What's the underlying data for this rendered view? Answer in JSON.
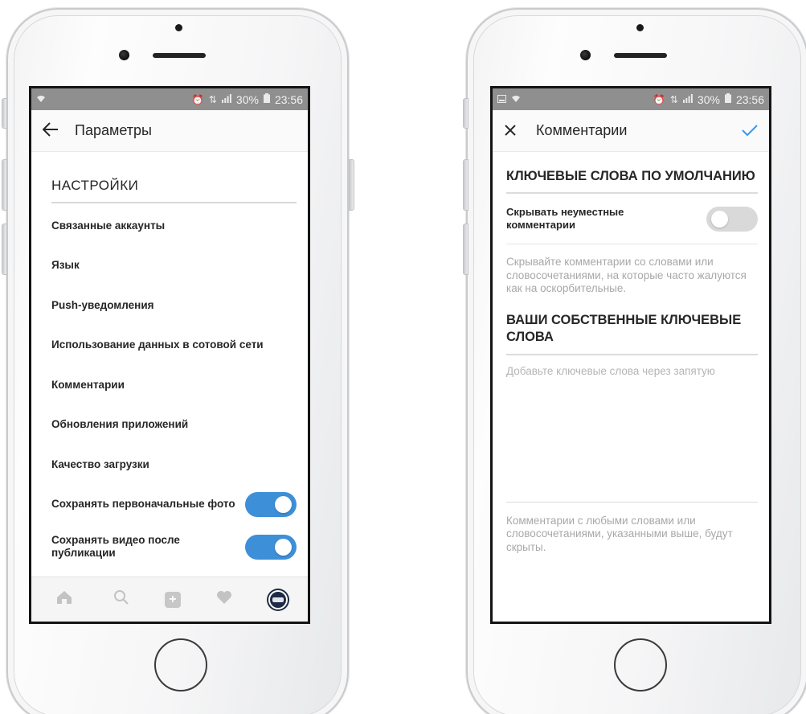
{
  "status_bar": {
    "left_screen": {
      "battery": "30%",
      "time": "23:56"
    },
    "right_screen": {
      "battery": "30%",
      "time": "23:56"
    }
  },
  "settings_screen": {
    "title": "Параметры",
    "section_title": "НАСТРОЙКИ",
    "items": [
      {
        "label": "Связанные аккаунты"
      },
      {
        "label": "Язык"
      },
      {
        "label": "Push-уведомления"
      },
      {
        "label": "Использование данных в сотовой сети"
      },
      {
        "label": "Комментарии"
      },
      {
        "label": "Обновления приложений"
      },
      {
        "label": "Качество загрузки"
      },
      {
        "label": "Сохранять первоначальные фото",
        "toggle": "on"
      },
      {
        "label": "Сохранять видео после публикации",
        "toggle": "on"
      }
    ],
    "tab_bar": [
      "home-icon",
      "search-icon",
      "add-icon",
      "heart-icon",
      "profile-avatar"
    ]
  },
  "comments_screen": {
    "title": "Комментарии",
    "default_keywords_title": "КЛЮЧЕВЫЕ СЛОВА ПО УМОЛЧАНИЮ",
    "hide_offensive_label": "Скрывать неуместные комментарии",
    "hide_offensive_toggle": "off",
    "hide_offensive_hint": "Скрывайте комментарии со словами или словосочетаниями, на которые часто жалуются как на оскорбительные.",
    "own_keywords_title": "ВАШИ СОБСТВЕННЫЕ КЛЮЧЕВЫЕ СЛОВА",
    "keywords_placeholder": "Добавьте ключевые слова через запятую",
    "keywords_value": "",
    "footer_note": "Комментарии с любыми словами или словосочетаниями, указанными выше, будут скрыты."
  },
  "colors": {
    "accent": "#3897f0",
    "toggle_on": "#3d8fd8",
    "status_bar": "#8f8f8f"
  }
}
